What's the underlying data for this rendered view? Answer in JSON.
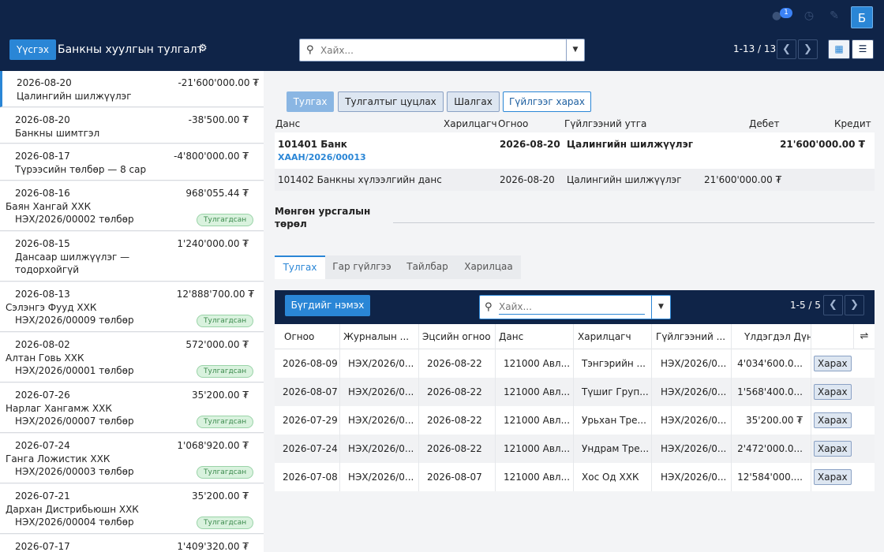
{
  "topbar": {
    "notification_count": "1",
    "avatar_letter": "Б"
  },
  "control_panel": {
    "create_label": "Үүсгэх",
    "title": "Банкны хуулгын тулгалт",
    "search_placeholder": "Хайх...",
    "pager": "1-13 / 13"
  },
  "statements": [
    {
      "date": "2026-08-20",
      "amount": "-21'600'000.00 ₮",
      "line2": "Цалингийн шилжүүлэг",
      "line3": "",
      "tag": ""
    },
    {
      "date": "2026-08-20",
      "amount": "-38'500.00 ₮",
      "line2": "Банкны шимтгэл",
      "line3": "",
      "tag": ""
    },
    {
      "date": "2026-08-17",
      "amount": "-4'800'000.00 ₮",
      "line2": "Түрээсийн төлбөр — 8 сар",
      "line3": "",
      "tag": ""
    },
    {
      "date": "2026-08-16",
      "amount": "968'055.44 ₮",
      "line2": "Баян Хангай ХХК",
      "line3": "НЭХ/2026/00002 төлбөр",
      "tag": "Тулгагдсан"
    },
    {
      "date": "2026-08-15",
      "amount": "1'240'000.00 ₮",
      "line2": "Дансаар шилжүүлэг —",
      "line3": "тодорхойгүй",
      "tag": ""
    },
    {
      "date": "2026-08-13",
      "amount": "12'888'700.00 ₮",
      "line2": "Сэлэнгэ Фууд ХХК",
      "line3": "НЭХ/2026/00009 төлбөр",
      "tag": "Тулгагдсан"
    },
    {
      "date": "2026-08-02",
      "amount": "572'000.00 ₮",
      "line2": "Алтан Говь ХХК",
      "line3": "НЭХ/2026/00001 төлбөр",
      "tag": "Тулгагдсан"
    },
    {
      "date": "2026-07-26",
      "amount": "35'200.00 ₮",
      "line2": "Нарлаг Хангамж ХХК",
      "line3": "НЭХ/2026/00007 төлбөр",
      "tag": "Тулгагдсан"
    },
    {
      "date": "2026-07-24",
      "amount": "1'068'920.00 ₮",
      "line2": "Ганга Ложистик ХХК",
      "line3": "НЭХ/2026/00003 төлбөр",
      "tag": "Тулгагдсан"
    },
    {
      "date": "2026-07-21",
      "amount": "35'200.00 ₮",
      "line2": "Дархан Дистрибьюшн ХХК",
      "line3": "НЭХ/2026/00004 төлбөр",
      "tag": "Тулгагдсан"
    },
    {
      "date": "2026-07-17",
      "amount": "1'409'320.00 ₮",
      "line2": "",
      "line3": "",
      "tag": ""
    }
  ],
  "actions": {
    "reconcile": "Тулгах",
    "cancel_reconcile": "Тулгалтыг цуцлах",
    "check": "Шалгах",
    "view_moves": "Гүйлгээг харах"
  },
  "lines_header": {
    "account": "Данс",
    "partner": "Харилцагч",
    "date": "Огноо",
    "label": "Гүйлгээний утга",
    "debit": "Дебет",
    "credit": "Кредит"
  },
  "line1": {
    "account": "101401 Банк",
    "ref": "ХААН/2026/00013",
    "date": "2026-08-20",
    "label": "Цалингийн шилжүүлэг",
    "credit": "21'600'000.00 ₮"
  },
  "line2": {
    "account": "101402 Банкны хүлээлгийн данс",
    "date": "2026-08-20",
    "label": "Цалингийн шилжүүлэг",
    "debit": "21'600'000.00 ₮"
  },
  "money_label_1": "Мөнгөн урсгалын",
  "money_label_2": "төрөл",
  "tabs": [
    "Тулгах",
    "Гар гүйлгээ",
    "Тайлбар",
    "Харилцаа"
  ],
  "subpanel": {
    "add_label": "Бүгдийг нэмэх",
    "search_placeholder": "Хайх...",
    "pager": "1-5 / 5"
  },
  "table": {
    "headers": [
      "Огноо",
      "Журналын ...",
      "Эцсийн огноо",
      "Данс",
      "Харилцагч",
      "Гүйлгээний ...",
      "Үлдэгдэл Дүн"
    ],
    "view_label": "Харах",
    "rows": [
      [
        "2026-08-09",
        "НЭХ/2026/0...",
        "2026-08-22",
        "121000 Авл...",
        "Тэнгэрийн ...",
        "НЭХ/2026/0...",
        "4'034'600.0..."
      ],
      [
        "2026-08-07",
        "НЭХ/2026/0...",
        "2026-08-22",
        "121000 Авл...",
        "Түшиг Груп...",
        "НЭХ/2026/0...",
        "1'568'400.0..."
      ],
      [
        "2026-07-29",
        "НЭХ/2026/0...",
        "2026-08-22",
        "121000 Авл...",
        "Урьхан Тре...",
        "НЭХ/2026/0...",
        "35'200.00 ₮"
      ],
      [
        "2026-07-24",
        "НЭХ/2026/0...",
        "2026-08-22",
        "121000 Авл...",
        "Ундрам Тре...",
        "НЭХ/2026/0...",
        "2'472'000.0..."
      ],
      [
        "2026-07-08",
        "НЭХ/2026/0...",
        "2026-08-07",
        "121000 Авл...",
        "Хос Од ХХК",
        "НЭХ/2026/0...",
        "12'584'000...."
      ]
    ]
  }
}
